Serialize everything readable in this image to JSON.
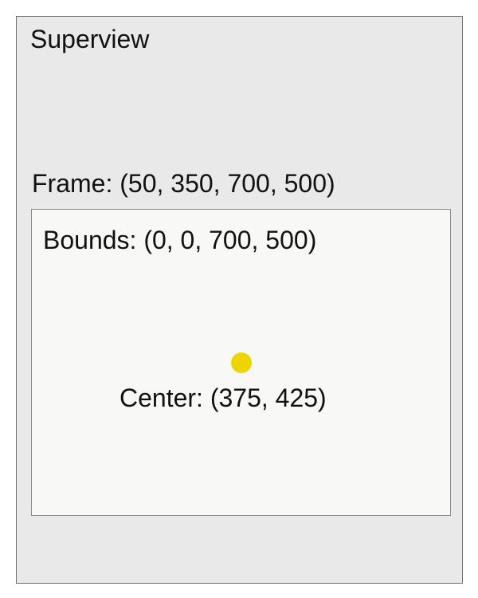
{
  "superview": {
    "title": "Superview"
  },
  "subview": {
    "frame_label": "Frame: (50, 350, 700, 500)",
    "bounds_label": "Bounds: (0, 0, 700, 500)",
    "center_label": "Center: (375, 425)"
  },
  "colors": {
    "superview_fill": "#e9e9e9",
    "subview_fill": "#f8f8f7",
    "center_dot": "#f0d400",
    "text": "#111111"
  },
  "icons": {
    "center_marker": "center-point-icon"
  }
}
